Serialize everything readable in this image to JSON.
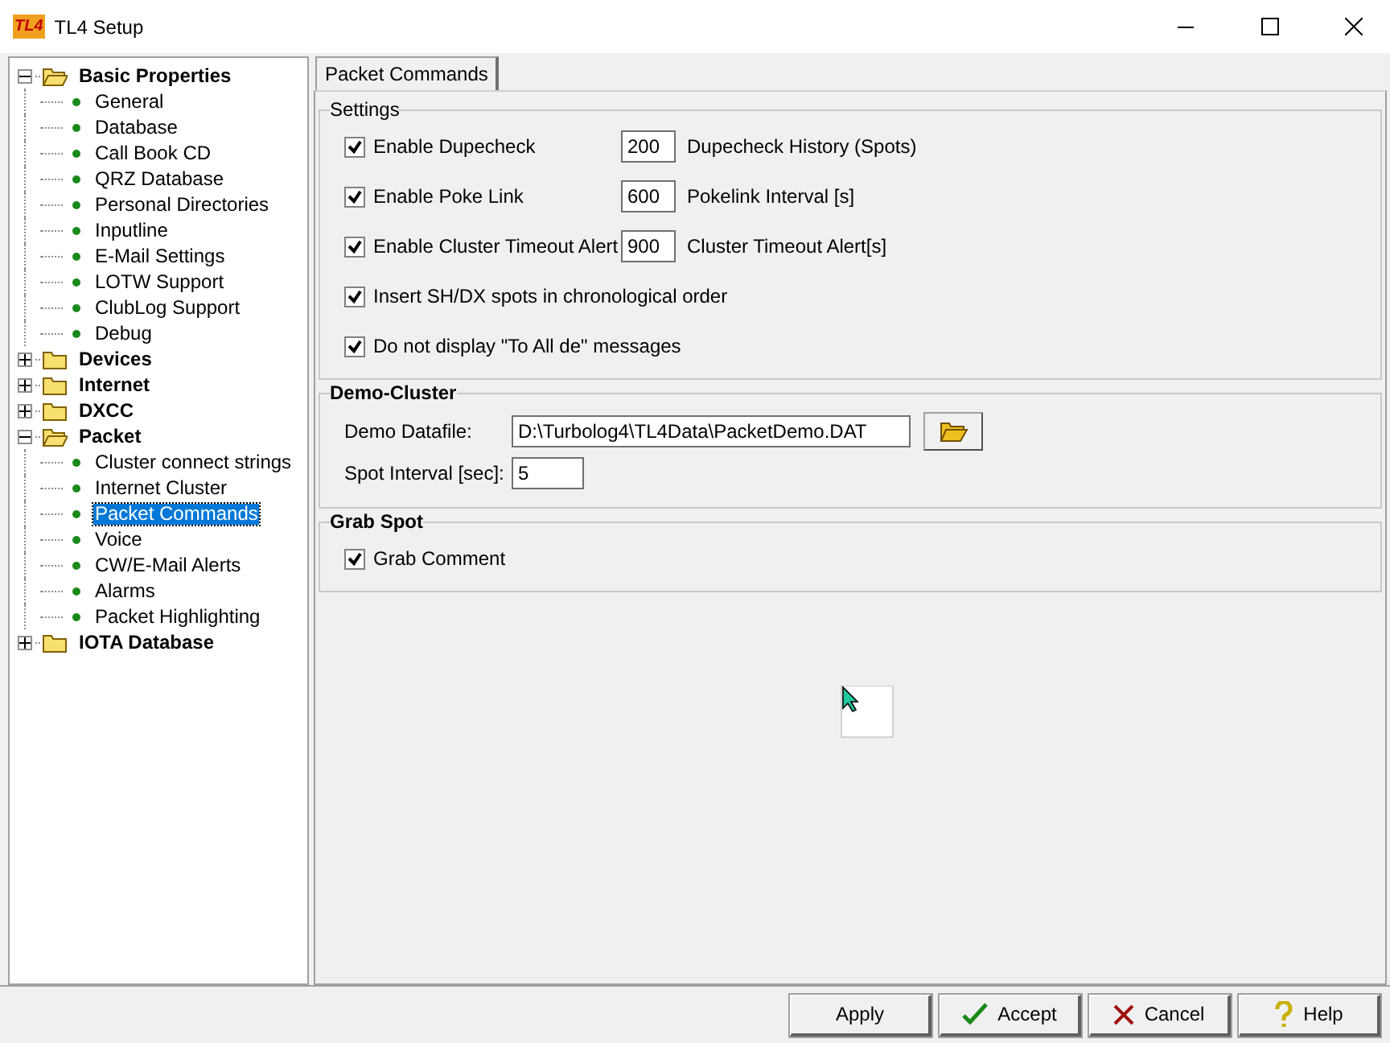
{
  "window": {
    "logo": "TL4",
    "title": "TL4 Setup"
  },
  "tree": [
    {
      "kind": "folder",
      "label": "Basic Properties",
      "expanded": true,
      "selected": false,
      "children": [
        {
          "kind": "leaf",
          "label": "General",
          "selected": false
        },
        {
          "kind": "leaf",
          "label": "Database",
          "selected": false
        },
        {
          "kind": "leaf",
          "label": "Call Book CD",
          "selected": false
        },
        {
          "kind": "leaf",
          "label": "QRZ Database",
          "selected": false
        },
        {
          "kind": "leaf",
          "label": "Personal Directories",
          "selected": false
        },
        {
          "kind": "leaf",
          "label": "Inputline",
          "selected": false
        },
        {
          "kind": "leaf",
          "label": "E-Mail Settings",
          "selected": false
        },
        {
          "kind": "leaf",
          "label": "LOTW Support",
          "selected": false
        },
        {
          "kind": "leaf",
          "label": "ClubLog Support",
          "selected": false
        },
        {
          "kind": "leaf",
          "label": "Debug",
          "selected": false
        }
      ]
    },
    {
      "kind": "folder",
      "label": "Devices",
      "expanded": false,
      "selected": false
    },
    {
      "kind": "folder",
      "label": "Internet",
      "expanded": false,
      "selected": false
    },
    {
      "kind": "folder",
      "label": "DXCC",
      "expanded": false,
      "selected": false
    },
    {
      "kind": "folder",
      "label": "Packet",
      "expanded": true,
      "selected": false,
      "children": [
        {
          "kind": "leaf",
          "label": "Cluster connect strings",
          "selected": false
        },
        {
          "kind": "leaf",
          "label": "Internet Cluster",
          "selected": false
        },
        {
          "kind": "leaf",
          "label": "Packet Commands",
          "selected": true
        },
        {
          "kind": "leaf",
          "label": "Voice",
          "selected": false
        },
        {
          "kind": "leaf",
          "label": "CW/E-Mail Alerts",
          "selected": false
        },
        {
          "kind": "leaf",
          "label": "Alarms",
          "selected": false
        },
        {
          "kind": "leaf",
          "label": "Packet Highlighting",
          "selected": false
        }
      ]
    },
    {
      "kind": "folder",
      "label": "IOTA Database",
      "expanded": false,
      "selected": false
    }
  ],
  "tabs": [
    {
      "label": "Packet Commands",
      "selected": true
    }
  ],
  "settings": {
    "title": "Settings",
    "options": [
      {
        "label": "Enable Dupecheck",
        "checked": true,
        "value": "200",
        "unit": "Dupecheck History (Spots)"
      },
      {
        "label": "Enable Poke Link",
        "checked": true,
        "value": "600",
        "unit": "Pokelink Interval [s]"
      },
      {
        "label": "Enable Cluster Timeout Alert",
        "checked": true,
        "value": "900",
        "unit": "Cluster Timeout Alert[s]"
      },
      {
        "label": "Insert SH/DX spots in chronological order",
        "checked": true
      },
      {
        "label": "Do not display \"To All de\" messages",
        "checked": true
      }
    ]
  },
  "demo_cluster": {
    "title": "Demo-Cluster",
    "datafile_label": "Demo Datafile:",
    "datafile": "D:\\Turbolog4\\TL4Data\\PacketDemo.DAT",
    "interval_label": "Spot Interval [sec]:",
    "interval": "5"
  },
  "grab_spot": {
    "title": "Grab Spot",
    "options": [
      {
        "label": "Grab Comment",
        "checked": true
      }
    ]
  },
  "buttons": [
    {
      "kind": "apply",
      "label": "Apply"
    },
    {
      "kind": "accept",
      "label": "Accept"
    },
    {
      "kind": "cancel",
      "label": "Cancel"
    },
    {
      "kind": "help",
      "label": "Help"
    }
  ]
}
